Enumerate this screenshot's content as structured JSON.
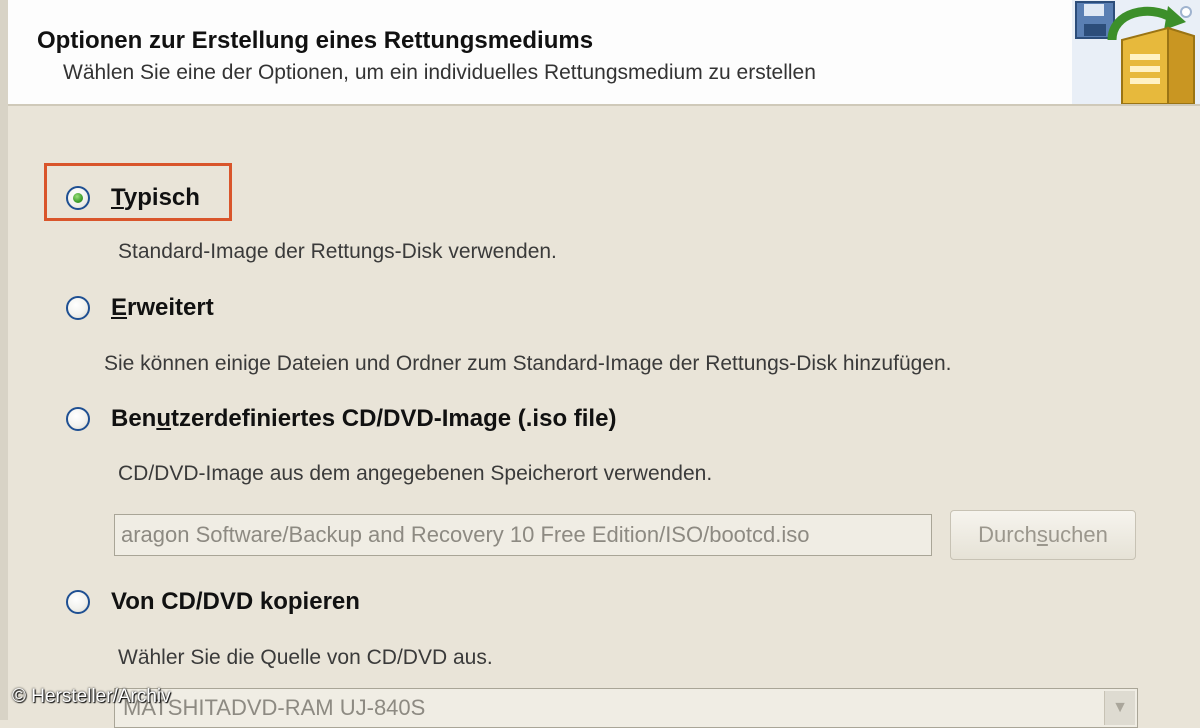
{
  "header": {
    "title": "Optionen zur Erstellung eines Rettungsmediums",
    "subtitle": "Wählen Sie eine der Optionen, um ein individuelles Rettungsmedium zu erstellen"
  },
  "options": [
    {
      "label_u": "T",
      "label_rest": "ypisch",
      "description": "Standard-Image der Rettungs-Disk verwenden.",
      "selected": true
    },
    {
      "label_u": "E",
      "label_rest": "rweitert",
      "description": "Sie können einige Dateien und Ordner zum Standard-Image der Rettungs-Disk hinzufügen.",
      "selected": false
    },
    {
      "label_pre": "Ben",
      "label_u": "u",
      "label_rest": "tzerdefiniertes CD/DVD-Image (.iso file)",
      "description": "CD/DVD-Image aus dem angegebenen Speicherort verwenden.",
      "selected": false
    },
    {
      "label": "Von CD/DVD kopieren",
      "description": "Wähler Sie die Quelle von CD/DVD aus.",
      "selected": false
    }
  ],
  "iso_path": {
    "value": "aragon Software/Backup and Recovery 10 Free Edition/ISO/bootcd.iso"
  },
  "browse_button": {
    "pre": "Durch",
    "u": "s",
    "rest": "uchen"
  },
  "drive_select": {
    "value": "MATSHITADVD-RAM UJ-840S"
  },
  "watermark": "© Hersteller/Archiv",
  "colors": {
    "highlight": "#d9552b",
    "radio_border": "#1e4f92",
    "radio_dot": "#3f9f2d"
  }
}
